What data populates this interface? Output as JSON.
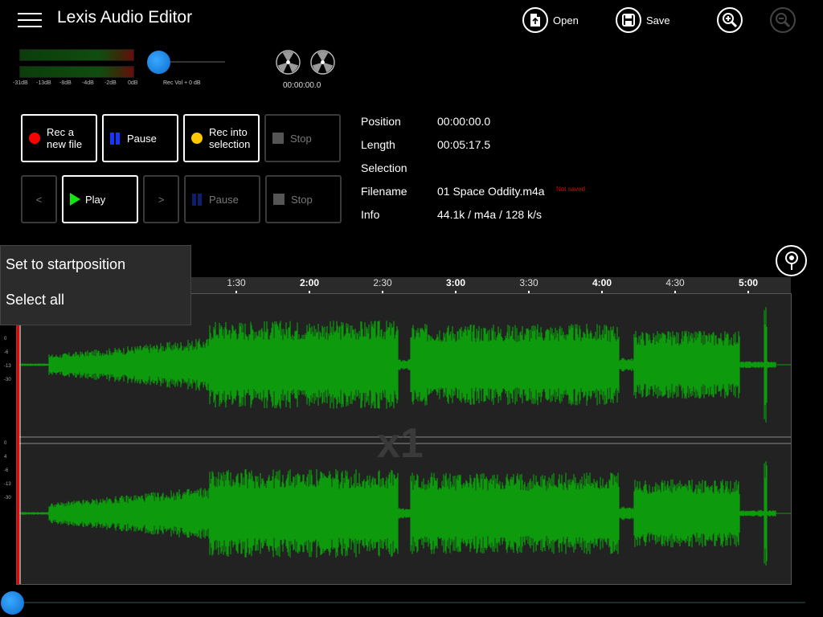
{
  "header": {
    "title": "Lexis Audio Editor",
    "open_label": "Open",
    "save_label": "Save",
    "zoom_in_icon": "zoom-in-icon",
    "zoom_out_icon": "zoom-out-icon"
  },
  "meter": {
    "ticks": [
      "-31dB",
      "-13dB",
      "-8dB",
      "-4dB",
      "-2dB",
      "0dB"
    ],
    "rec_vol_label": "Rec Vol + 0 dB"
  },
  "reels": {
    "time": "00:00:00.0"
  },
  "transport": {
    "rec_new": "Rec a new file",
    "pause_top": "Pause",
    "rec_selection": "Rec into selection",
    "stop_top": "Stop",
    "prev": "<",
    "play": "Play",
    "next": ">",
    "pause_bottom": "Pause",
    "stop_bottom": "Stop",
    "colors": {
      "rec": "#ff0000",
      "rec_selection": "#ffc800",
      "play": "#11e611",
      "pause": "#1436ff"
    }
  },
  "info": {
    "position_label": "Position",
    "position_value": "00:00:00.0",
    "length_label": "Length",
    "length_value": "00:05:17.5",
    "selection_label": "Selection",
    "selection_value": "",
    "filename_label": "Filename",
    "filename_value": "01 Space Oddity.m4a",
    "not_saved": "Not saved",
    "info_label": "Info",
    "info_value": "44.1k / m4a / 128 k/s"
  },
  "timeline": {
    "ticks": [
      {
        "label": "1:30",
        "bold": false
      },
      {
        "label": "2:00",
        "bold": true
      },
      {
        "label": "2:30",
        "bold": false
      },
      {
        "label": "3:00",
        "bold": true
      },
      {
        "label": "3:30",
        "bold": false
      },
      {
        "label": "4:00",
        "bold": true
      },
      {
        "label": "4:30",
        "bold": false
      },
      {
        "label": "5:00",
        "bold": true
      }
    ]
  },
  "waveform": {
    "zoom_label": "x1",
    "db_labels_top": [
      "0",
      "-6",
      "-13",
      "-30"
    ],
    "db_labels_bottom": [
      "0",
      "4",
      "-6",
      "-13",
      "-30"
    ],
    "color": "#0d9a0d"
  },
  "context_menu": {
    "items": [
      "Set to startposition",
      "Select all"
    ]
  }
}
